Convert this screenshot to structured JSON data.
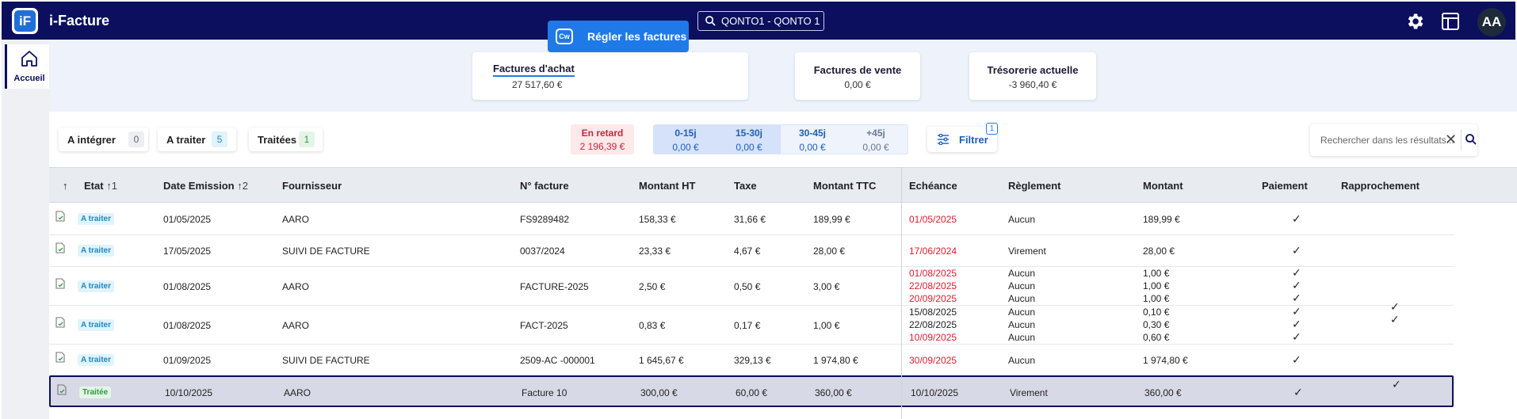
{
  "app": {
    "logo": "iF",
    "name": "i-Facture",
    "company": "QONTO1 - QONTO 1",
    "avatar": "AA",
    "icons": [
      "search-icon",
      "gear-icon",
      "layout-icon"
    ]
  },
  "sidebar": {
    "home_label": "Accueil"
  },
  "summary": {
    "achat": {
      "title": "Factures d'achat",
      "value": "27 517,60 €"
    },
    "pay_button": "Régler les factures",
    "pay_icon": "Cw",
    "vente": {
      "title": "Factures de vente",
      "value": "0,00 €"
    },
    "tresorerie": {
      "title": "Trésorerie actuelle",
      "value": "-3 960,40 €"
    }
  },
  "status_tabs": [
    {
      "label": "A intégrer",
      "count": "0"
    },
    {
      "label": "A traiter",
      "count": "5"
    },
    {
      "label": "Traitées",
      "count": "1"
    }
  ],
  "late": {
    "label": "En retard",
    "value": "2 196,39 €"
  },
  "buckets": [
    {
      "label": "0-15j",
      "value": "0,00 €"
    },
    {
      "label": "15-30j",
      "value": "0,00 €"
    },
    {
      "label": "30-45j",
      "value": "0,00 €"
    },
    {
      "label": "+45j",
      "value": "0,00 €"
    }
  ],
  "filter": {
    "label": "Filtrer",
    "count": "1"
  },
  "search": {
    "placeholder": "Rechercher dans les résultats...",
    "clear": "✕"
  },
  "table": {
    "sort_arrow": "↑",
    "headers": {
      "etat": "Etat",
      "etat_sort": "↑1",
      "date": "Date Emission",
      "date_sort": "↑2",
      "fournisseur": "Fournisseur",
      "num": "N° facture",
      "ht": "Montant HT",
      "taxe": "Taxe",
      "ttc": "Montant TTC",
      "echeance": "Echéance",
      "reglement": "Règlement",
      "montant": "Montant",
      "paiement": "Paiement",
      "rapprochement": "Rapprochement"
    },
    "check": "✓",
    "rows": [
      {
        "etat": "A traiter",
        "date": "01/05/2025",
        "fournisseur": "AARO",
        "num": "FS9289482",
        "ht": "158,33 €",
        "taxe": "31,66 €",
        "ttc": "189,99 €",
        "echeances": [
          {
            "date": "01/05/2025",
            "late": true,
            "reglement": "Aucun",
            "montant": "189,99 €",
            "paye": true,
            "rappro": false
          }
        ]
      },
      {
        "etat": "A traiter",
        "date": "17/05/2025",
        "fournisseur": "SUIVI DE FACTURE",
        "num": "0037/2024",
        "ht": "23,33 €",
        "taxe": "4,67 €",
        "ttc": "28,00 €",
        "echeances": [
          {
            "date": "17/06/2024",
            "late": true,
            "reglement": "Virement",
            "montant": "28,00 €",
            "paye": true,
            "rappro": false
          }
        ]
      },
      {
        "etat": "A traiter",
        "date": "01/08/2025",
        "fournisseur": "AARO",
        "num": "FACTURE-2025",
        "ht": "2,50 €",
        "taxe": "0,50 €",
        "ttc": "3,00 €",
        "echeances": [
          {
            "date": "01/08/2025",
            "late": true,
            "reglement": "Aucun",
            "montant": "1,00 €",
            "paye": true,
            "rappro": false
          },
          {
            "date": "22/08/2025",
            "late": true,
            "reglement": "Aucun",
            "montant": "1,00 €",
            "paye": true,
            "rappro": false
          },
          {
            "date": "20/09/2025",
            "late": true,
            "reglement": "Aucun",
            "montant": "1,00 €",
            "paye": true,
            "rappro": false
          }
        ]
      },
      {
        "etat": "A traiter",
        "date": "01/08/2025",
        "fournisseur": "AARO",
        "num": "FACT-2025",
        "ht": "0,83 €",
        "taxe": "0,17 €",
        "ttc": "1,00 €",
        "echeances": [
          {
            "date": "15/08/2025",
            "late": false,
            "reglement": "Aucun",
            "montant": "0,10 €",
            "paye": true,
            "rappro": true
          },
          {
            "date": "22/08/2025",
            "late": false,
            "reglement": "Aucun",
            "montant": "0,30 €",
            "paye": true,
            "rappro": true
          },
          {
            "date": "10/09/2025",
            "late": true,
            "reglement": "Aucun",
            "montant": "0,60 €",
            "paye": true,
            "rappro": false
          }
        ]
      },
      {
        "etat": "A traiter",
        "date": "01/09/2025",
        "fournisseur": "SUIVI DE FACTURE",
        "num": "2509-AC -000001",
        "ht": "1 645,67 €",
        "taxe": "329,13 €",
        "ttc": "1 974,80 €",
        "echeances": [
          {
            "date": "30/09/2025",
            "late": true,
            "reglement": "Aucun",
            "montant": "1 974,80 €",
            "paye": true,
            "rappro": false
          }
        ]
      },
      {
        "etat": "Traitée",
        "date": "10/10/2025",
        "fournisseur": "AARO",
        "num": "Facture 10",
        "ht": "300,00 €",
        "taxe": "60,00 €",
        "ttc": "360,00 €",
        "selected": true,
        "echeances": [
          {
            "date": "10/10/2025",
            "late": false,
            "reglement": "Virement",
            "montant": "360,00 €",
            "paye": true,
            "rappro": true
          }
        ]
      }
    ]
  },
  "colors": {
    "navy": "#0b0f5e",
    "accent": "#1f7ae8",
    "late": "#d6202f",
    "badge_traiter": "#1a8ac4",
    "badge_traitee": "#2e9a45"
  }
}
